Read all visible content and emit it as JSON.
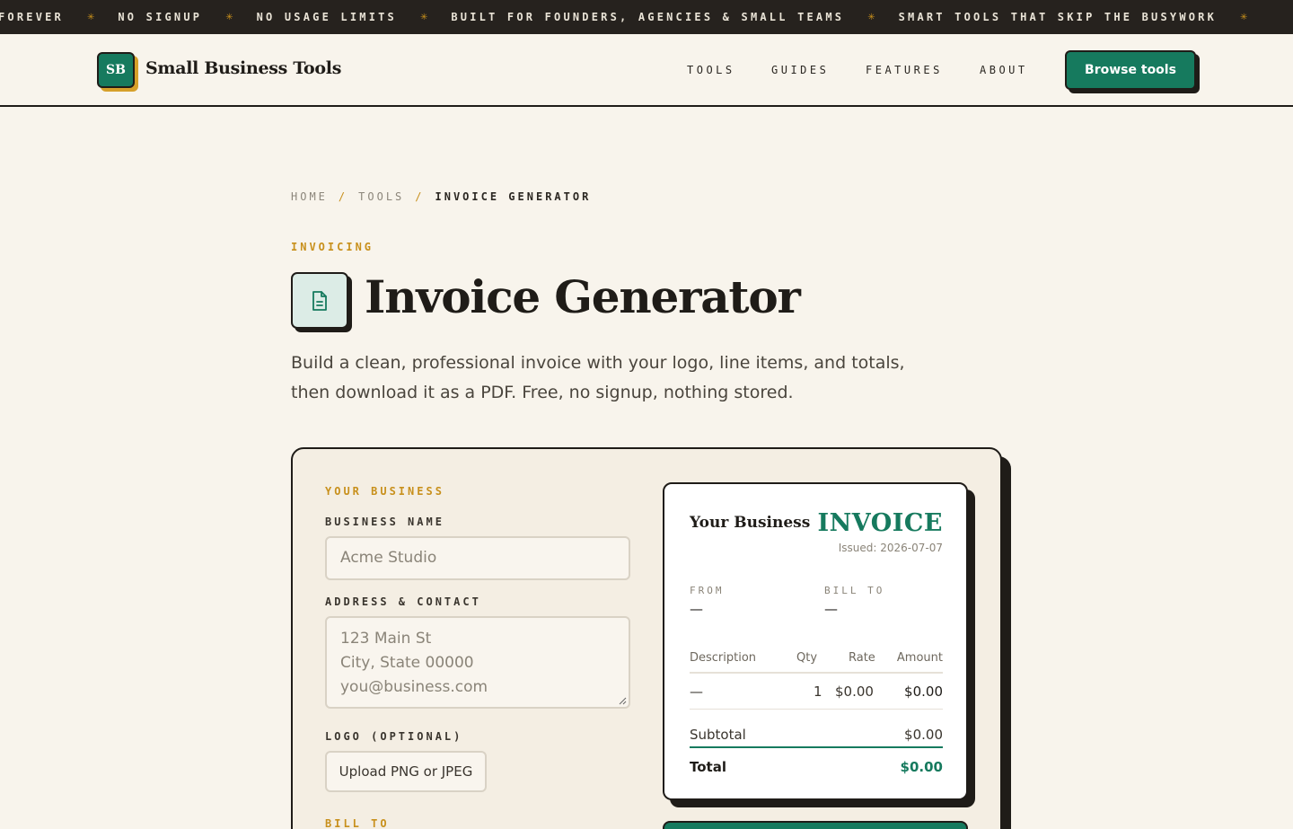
{
  "ticker": {
    "items": [
      "FOREVER",
      "NO SIGNUP",
      "NO USAGE LIMITS",
      "BUILT FOR FOUNDERS, AGENCIES & SMALL TEAMS",
      "SMART TOOLS THAT SKIP THE BUSYWORK"
    ],
    "separator": "✳"
  },
  "header": {
    "logo_text": "SB",
    "brand": "Small Business Tools",
    "nav": [
      "TOOLS",
      "GUIDES",
      "FEATURES",
      "ABOUT"
    ],
    "cta": "Browse tools"
  },
  "breadcrumb": {
    "home": "HOME",
    "sep": "/",
    "tools": "TOOLS",
    "current": "INVOICE GENERATOR"
  },
  "hero": {
    "eyebrow": "INVOICING",
    "title": "Invoice Generator",
    "subtitle": "Build a clean, professional invoice with your logo, line items, and totals, then download it as a PDF. Free, no signup, nothing stored.",
    "icon": "document-icon"
  },
  "form": {
    "section_business": "YOUR BUSINESS",
    "business_name_label": "BUSINESS NAME",
    "business_name_placeholder": "Acme Studio",
    "address_label": "ADDRESS & CONTACT",
    "address_placeholder": [
      "123 Main St",
      "City, State 00000",
      "you@business.com"
    ],
    "logo_label": "LOGO (OPTIONAL)",
    "upload_label": "Upload PNG or JPEG",
    "section_bill_to": "BILL TO"
  },
  "preview": {
    "business": "Your Business",
    "heading": "INVOICE",
    "issued": "Issued: 2026-07-07",
    "from_label": "FROM",
    "from_value": "—",
    "bill_to_label": "BILL TO",
    "bill_to_value": "—",
    "columns": {
      "description": "Description",
      "qty": "Qty",
      "rate": "Rate",
      "amount": "Amount"
    },
    "row": {
      "description": "—",
      "qty": "1",
      "rate": "$0.00",
      "amount": "$0.00"
    },
    "subtotal_label": "Subtotal",
    "subtotal_value": "$0.00",
    "total_label": "Total",
    "total_value": "$0.00"
  },
  "colors": {
    "accent": "#167a5e",
    "gold": "#c8901c",
    "ink": "#1f1c18",
    "background": "#f8f4ec"
  }
}
